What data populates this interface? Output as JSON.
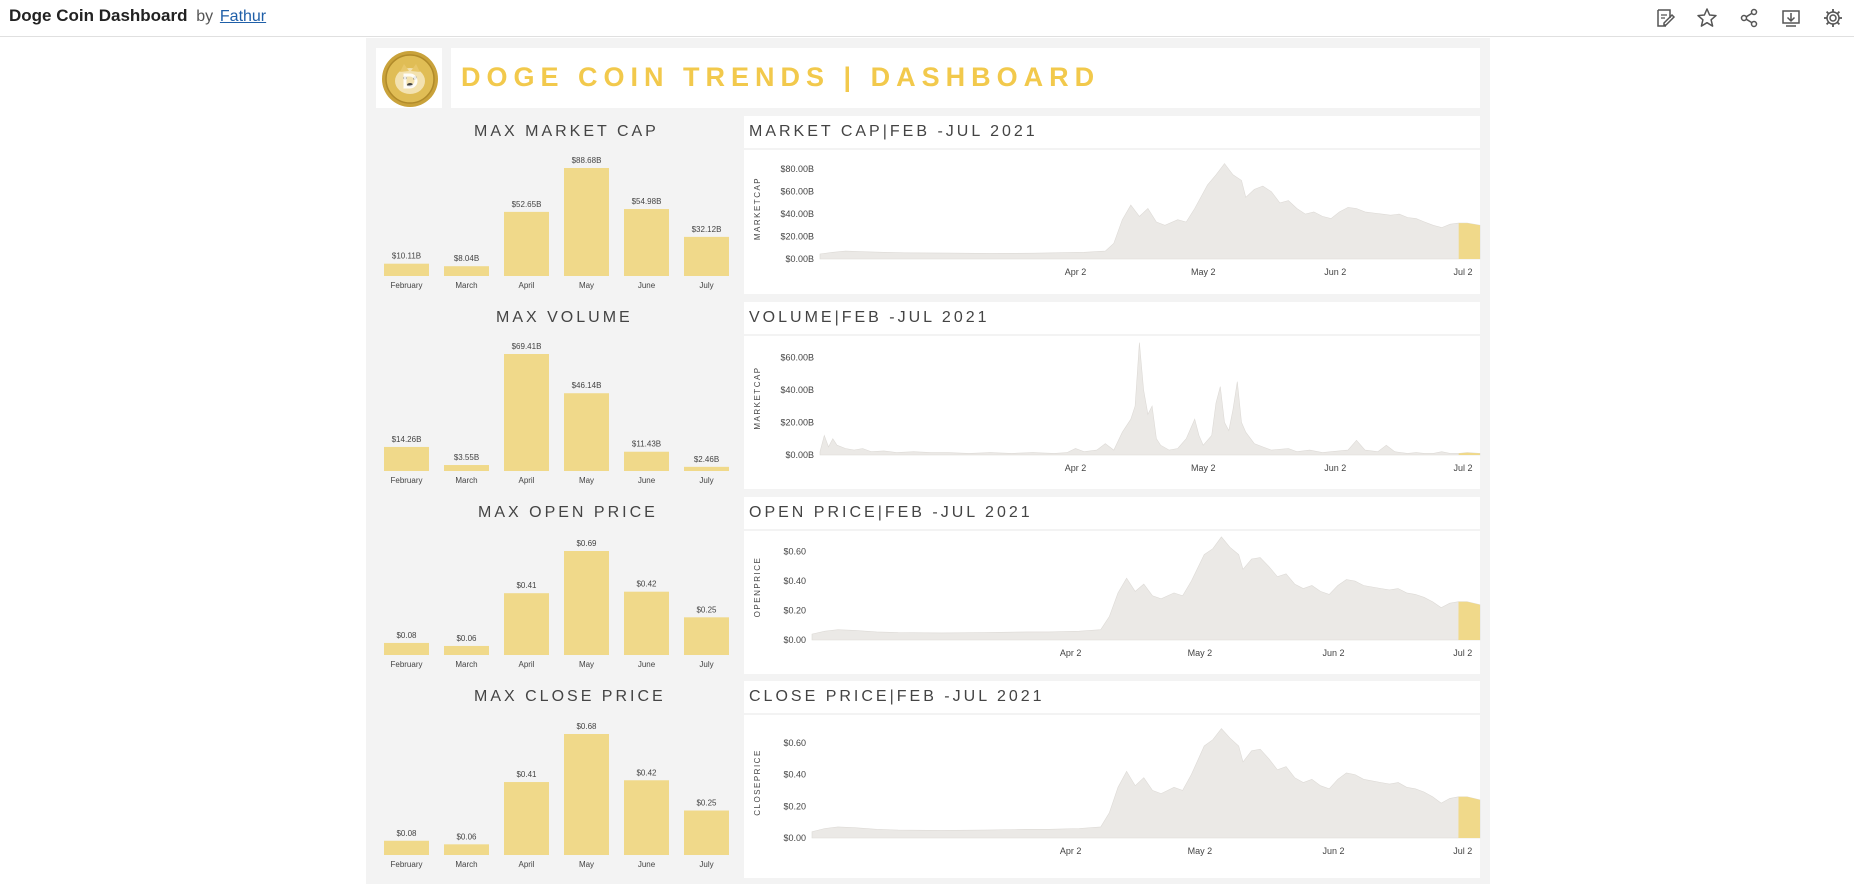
{
  "topbar": {
    "title": "Doge Coin Dashboard",
    "by": "by",
    "author": "Fathur",
    "icons": [
      "edit-icon",
      "star-icon",
      "share-icon",
      "download-icon",
      "settings-icon"
    ]
  },
  "header": {
    "title": "DOGE COIN TRENDS | DASHBOARD",
    "logo": "doge-coin-logo"
  },
  "colors": {
    "accent": "#f0d98a",
    "highlight": "#f2c94c",
    "area": "#ebe9e6",
    "title": "#f2c94c"
  },
  "chart_data": [
    {
      "type": "bar",
      "title": "MAX MARKET CAP",
      "categories": [
        "February",
        "March",
        "April",
        "May",
        "June",
        "July"
      ],
      "values": [
        10.11,
        8.04,
        52.65,
        88.68,
        54.98,
        32.12
      ],
      "labels": [
        "$10.11B",
        "$8.04B",
        "$52.65B",
        "$88.68B",
        "$54.98B",
        "$32.12B"
      ],
      "unit": "B USD"
    },
    {
      "type": "area",
      "title": "MARKET CAP|FEB -JUL 2021",
      "ylabel": "MARKETCAP",
      "yticks": [
        "$80.00B",
        "$60.00B",
        "$40.00B",
        "$20.00B",
        "$0.00B"
      ],
      "ytick_values": [
        80,
        60,
        40,
        20,
        0
      ],
      "ylim": [
        0,
        90
      ],
      "xticks": [
        "Apr 2",
        "May 2",
        "Jun 2",
        "Jul 2"
      ],
      "xtick_days": [
        60,
        90,
        121,
        151
      ],
      "x_range_days": [
        0,
        155
      ],
      "highlight_from_day": 150,
      "points": [
        [
          0,
          4.5
        ],
        [
          3,
          6
        ],
        [
          6,
          7
        ],
        [
          10,
          6.5
        ],
        [
          15,
          6
        ],
        [
          20,
          5.5
        ],
        [
          30,
          5.3
        ],
        [
          40,
          5
        ],
        [
          50,
          5.2
        ],
        [
          55,
          5.5
        ],
        [
          62,
          6
        ],
        [
          67,
          7
        ],
        [
          69,
          14
        ],
        [
          71,
          35
        ],
        [
          73,
          48
        ],
        [
          75,
          38
        ],
        [
          77,
          45
        ],
        [
          79,
          33
        ],
        [
          81,
          30
        ],
        [
          84,
          35
        ],
        [
          86,
          33
        ],
        [
          88,
          45
        ],
        [
          91,
          66
        ],
        [
          93,
          75
        ],
        [
          95,
          85
        ],
        [
          97,
          75
        ],
        [
          99,
          70
        ],
        [
          100,
          55
        ],
        [
          102,
          62
        ],
        [
          104,
          65
        ],
        [
          106,
          60
        ],
        [
          108,
          50
        ],
        [
          110,
          52
        ],
        [
          112,
          45
        ],
        [
          114,
          40
        ],
        [
          116,
          42
        ],
        [
          118,
          38
        ],
        [
          120,
          36
        ],
        [
          122,
          42
        ],
        [
          124,
          46
        ],
        [
          126,
          45
        ],
        [
          128,
          42
        ],
        [
          130,
          41
        ],
        [
          132,
          40
        ],
        [
          134,
          39
        ],
        [
          136,
          40
        ],
        [
          138,
          37
        ],
        [
          140,
          36
        ],
        [
          142,
          33
        ],
        [
          144,
          30
        ],
        [
          146,
          28
        ],
        [
          148,
          31
        ],
        [
          150,
          32
        ],
        [
          152,
          32
        ],
        [
          155,
          30
        ]
      ]
    },
    {
      "type": "bar",
      "title": "MAX VOLUME",
      "categories": [
        "February",
        "March",
        "April",
        "May",
        "June",
        "July"
      ],
      "values": [
        14.26,
        3.55,
        69.41,
        46.14,
        11.43,
        2.46
      ],
      "labels": [
        "$14.26B",
        "$3.55B",
        "$69.41B",
        "$46.14B",
        "$11.43B",
        "$2.46B"
      ],
      "unit": "B USD"
    },
    {
      "type": "area",
      "title": "VOLUME|FEB -JUL 2021",
      "ylabel": "MARKETCAP",
      "yticks": [
        "$60.00B",
        "$40.00B",
        "$20.00B",
        "$0.00B"
      ],
      "ytick_values": [
        60,
        40,
        20,
        0
      ],
      "ylim": [
        0,
        70
      ],
      "xticks": [
        "Apr 2",
        "May 2",
        "Jun 2",
        "Jul 2"
      ],
      "xtick_days": [
        60,
        90,
        121,
        151
      ],
      "x_range_days": [
        0,
        155
      ],
      "highlight_from_day": 150,
      "points": [
        [
          0,
          2
        ],
        [
          1,
          12
        ],
        [
          2,
          5
        ],
        [
          3,
          10
        ],
        [
          4,
          6
        ],
        [
          6,
          4
        ],
        [
          8,
          3
        ],
        [
          10,
          4
        ],
        [
          12,
          2
        ],
        [
          15,
          2.5
        ],
        [
          18,
          1.5
        ],
        [
          22,
          2
        ],
        [
          26,
          1.5
        ],
        [
          30,
          1.5
        ],
        [
          35,
          1
        ],
        [
          40,
          1.5
        ],
        [
          45,
          1
        ],
        [
          50,
          1.5
        ],
        [
          55,
          1
        ],
        [
          58,
          1.5
        ],
        [
          60,
          4
        ],
        [
          62,
          2
        ],
        [
          65,
          3
        ],
        [
          67,
          7
        ],
        [
          69,
          3
        ],
        [
          71,
          14
        ],
        [
          73,
          22
        ],
        [
          74,
          30
        ],
        [
          75,
          69
        ],
        [
          76,
          40
        ],
        [
          77,
          25
        ],
        [
          78,
          30
        ],
        [
          79,
          10
        ],
        [
          80,
          6
        ],
        [
          82,
          3
        ],
        [
          84,
          4
        ],
        [
          86,
          10
        ],
        [
          88,
          22
        ],
        [
          89,
          12
        ],
        [
          90,
          6
        ],
        [
          92,
          12
        ],
        [
          93,
          32
        ],
        [
          94,
          42
        ],
        [
          95,
          20
        ],
        [
          96,
          15
        ],
        [
          97,
          28
        ],
        [
          98,
          45
        ],
        [
          99,
          20
        ],
        [
          100,
          14
        ],
        [
          102,
          7
        ],
        [
          104,
          5
        ],
        [
          106,
          3
        ],
        [
          110,
          4
        ],
        [
          112,
          2
        ],
        [
          115,
          3
        ],
        [
          118,
          1.5
        ],
        [
          120,
          2
        ],
        [
          124,
          3
        ],
        [
          126,
          9
        ],
        [
          128,
          3
        ],
        [
          131,
          2
        ],
        [
          133,
          6
        ],
        [
          135,
          2
        ],
        [
          138,
          1
        ],
        [
          140,
          1.5
        ],
        [
          142,
          1
        ],
        [
          144,
          1
        ],
        [
          146,
          2
        ],
        [
          148,
          1
        ],
        [
          150,
          1
        ],
        [
          152,
          1.5
        ],
        [
          155,
          1
        ]
      ]
    },
    {
      "type": "bar",
      "title": "MAX OPEN PRICE",
      "categories": [
        "February",
        "March",
        "April",
        "May",
        "June",
        "July"
      ],
      "values": [
        0.08,
        0.06,
        0.41,
        0.69,
        0.42,
        0.25
      ],
      "labels": [
        "$0.08",
        "$0.06",
        "$0.41",
        "$0.69",
        "$0.42",
        "$0.25"
      ],
      "unit": "USD"
    },
    {
      "type": "area",
      "title": "OPEN PRICE|FEB -JUL 2021",
      "ylabel": "OPENPRICE",
      "yticks": [
        "$0.60",
        "$0.40",
        "$0.20",
        "$0.00"
      ],
      "ytick_values": [
        0.6,
        0.4,
        0.2,
        0
      ],
      "ylim": [
        0,
        0.72
      ],
      "xticks": [
        "Apr 2",
        "May 2",
        "Jun 2",
        "Jul 2"
      ],
      "xtick_days": [
        60,
        90,
        121,
        151
      ],
      "x_range_days": [
        0,
        155
      ],
      "highlight_from_day": 150,
      "points": [
        [
          0,
          0.04
        ],
        [
          3,
          0.06
        ],
        [
          6,
          0.07
        ],
        [
          10,
          0.065
        ],
        [
          15,
          0.055
        ],
        [
          20,
          0.05
        ],
        [
          30,
          0.048
        ],
        [
          40,
          0.05
        ],
        [
          50,
          0.055
        ],
        [
          55,
          0.055
        ],
        [
          62,
          0.06
        ],
        [
          67,
          0.07
        ],
        [
          69,
          0.16
        ],
        [
          71,
          0.32
        ],
        [
          73,
          0.42
        ],
        [
          75,
          0.33
        ],
        [
          77,
          0.38
        ],
        [
          79,
          0.3
        ],
        [
          81,
          0.28
        ],
        [
          84,
          0.32
        ],
        [
          86,
          0.3
        ],
        [
          88,
          0.4
        ],
        [
          91,
          0.58
        ],
        [
          93,
          0.62
        ],
        [
          95,
          0.7
        ],
        [
          97,
          0.63
        ],
        [
          99,
          0.58
        ],
        [
          100,
          0.48
        ],
        [
          102,
          0.55
        ],
        [
          104,
          0.56
        ],
        [
          106,
          0.5
        ],
        [
          108,
          0.43
        ],
        [
          110,
          0.45
        ],
        [
          112,
          0.38
        ],
        [
          114,
          0.35
        ],
        [
          116,
          0.37
        ],
        [
          118,
          0.33
        ],
        [
          120,
          0.31
        ],
        [
          122,
          0.37
        ],
        [
          124,
          0.41
        ],
        [
          126,
          0.4
        ],
        [
          128,
          0.37
        ],
        [
          130,
          0.36
        ],
        [
          132,
          0.35
        ],
        [
          134,
          0.34
        ],
        [
          136,
          0.35
        ],
        [
          138,
          0.32
        ],
        [
          140,
          0.31
        ],
        [
          142,
          0.29
        ],
        [
          144,
          0.26
        ],
        [
          146,
          0.22
        ],
        [
          148,
          0.25
        ],
        [
          150,
          0.26
        ],
        [
          152,
          0.26
        ],
        [
          155,
          0.24
        ]
      ]
    },
    {
      "type": "bar",
      "title": "MAX CLOSE PRICE",
      "categories": [
        "February",
        "March",
        "April",
        "May",
        "June",
        "July"
      ],
      "values": [
        0.08,
        0.06,
        0.41,
        0.68,
        0.42,
        0.25
      ],
      "labels": [
        "$0.08",
        "$0.06",
        "$0.41",
        "$0.68",
        "$0.42",
        "$0.25"
      ],
      "unit": "USD"
    },
    {
      "type": "area",
      "title": "CLOSE PRICE|FEB -JUL 2021",
      "ylabel": "CLOSEPRICE",
      "yticks": [
        "$0.60",
        "$0.40",
        "$0.20",
        "$0.00"
      ],
      "ytick_values": [
        0.6,
        0.4,
        0.2,
        0
      ],
      "ylim": [
        0,
        0.7
      ],
      "xticks": [
        "Apr 2",
        "May 2",
        "Jun 2",
        "Jul 2"
      ],
      "xtick_days": [
        60,
        90,
        121,
        151
      ],
      "x_range_days": [
        0,
        155
      ],
      "highlight_from_day": 150,
      "points": [
        [
          0,
          0.04
        ],
        [
          3,
          0.06
        ],
        [
          6,
          0.07
        ],
        [
          10,
          0.065
        ],
        [
          15,
          0.055
        ],
        [
          20,
          0.05
        ],
        [
          30,
          0.048
        ],
        [
          40,
          0.05
        ],
        [
          50,
          0.055
        ],
        [
          55,
          0.055
        ],
        [
          62,
          0.06
        ],
        [
          67,
          0.07
        ],
        [
          69,
          0.16
        ],
        [
          71,
          0.32
        ],
        [
          73,
          0.42
        ],
        [
          75,
          0.33
        ],
        [
          77,
          0.38
        ],
        [
          79,
          0.3
        ],
        [
          81,
          0.28
        ],
        [
          84,
          0.32
        ],
        [
          86,
          0.3
        ],
        [
          88,
          0.4
        ],
        [
          91,
          0.58
        ],
        [
          93,
          0.62
        ],
        [
          95,
          0.69
        ],
        [
          97,
          0.63
        ],
        [
          99,
          0.58
        ],
        [
          100,
          0.48
        ],
        [
          102,
          0.55
        ],
        [
          104,
          0.56
        ],
        [
          106,
          0.5
        ],
        [
          108,
          0.43
        ],
        [
          110,
          0.45
        ],
        [
          112,
          0.38
        ],
        [
          114,
          0.35
        ],
        [
          116,
          0.37
        ],
        [
          118,
          0.33
        ],
        [
          120,
          0.31
        ],
        [
          122,
          0.37
        ],
        [
          124,
          0.41
        ],
        [
          126,
          0.4
        ],
        [
          128,
          0.37
        ],
        [
          130,
          0.36
        ],
        [
          132,
          0.35
        ],
        [
          134,
          0.34
        ],
        [
          136,
          0.35
        ],
        [
          138,
          0.32
        ],
        [
          140,
          0.31
        ],
        [
          142,
          0.29
        ],
        [
          144,
          0.26
        ],
        [
          146,
          0.22
        ],
        [
          148,
          0.25
        ],
        [
          150,
          0.26
        ],
        [
          152,
          0.26
        ],
        [
          155,
          0.24
        ]
      ]
    }
  ]
}
